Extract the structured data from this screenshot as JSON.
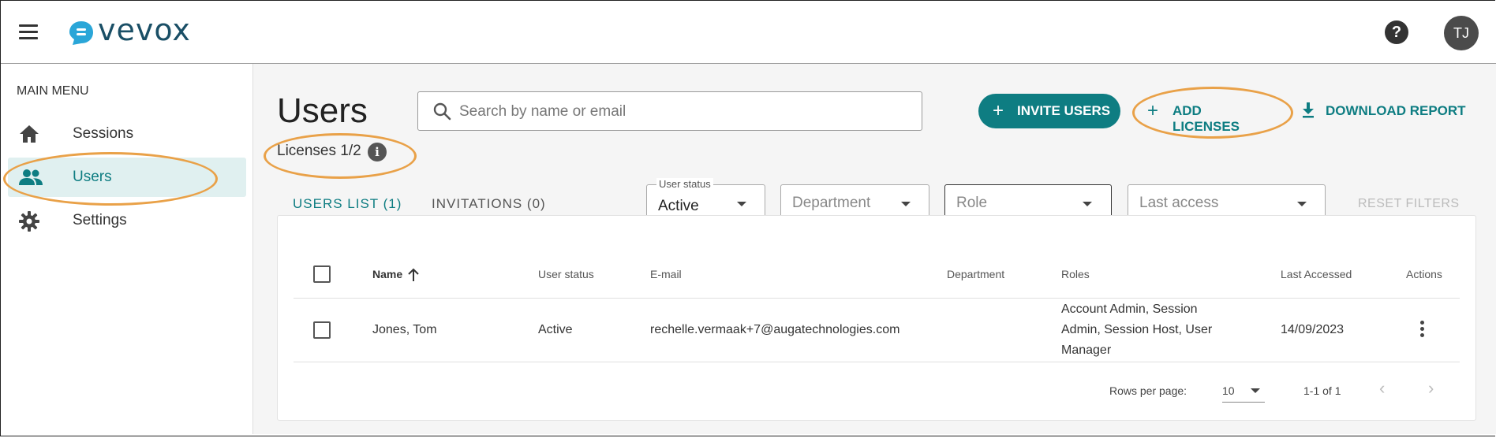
{
  "header": {
    "logo_text": "vevox",
    "avatar_initials": "TJ",
    "help_symbol": "?"
  },
  "sidebar": {
    "section_label": "MAIN MENU",
    "items": [
      {
        "label": "Sessions",
        "icon": "home-icon",
        "active": false
      },
      {
        "label": "Users",
        "icon": "people-icon",
        "active": true
      },
      {
        "label": "Settings",
        "icon": "gear-icon",
        "active": false
      }
    ]
  },
  "main": {
    "title": "Users",
    "licenses_text": "Licenses 1/2",
    "search": {
      "placeholder": "Search by name or email",
      "value": ""
    },
    "buttons": {
      "invite": "INVITE USERS",
      "add_licenses": "ADD LICENSES",
      "download_report": "DOWNLOAD REPORT"
    },
    "tabs": [
      {
        "label": "USERS LIST (1)",
        "active": true
      },
      {
        "label": "INVITATIONS (0)",
        "active": false
      }
    ],
    "filters": {
      "user_status": {
        "label": "User status",
        "value": "Active"
      },
      "department": {
        "placeholder": "Department"
      },
      "role": {
        "placeholder": "Role"
      },
      "last_access": {
        "placeholder": "Last access"
      },
      "reset": "RESET FILTERS"
    },
    "table": {
      "columns": [
        "Name",
        "User status",
        "E-mail",
        "Department",
        "Roles",
        "Last Accessed",
        "Actions"
      ],
      "sort_column": "Name",
      "sort_direction": "ascending",
      "rows": [
        {
          "name": "Jones, Tom",
          "status": "Active",
          "email": "rechelle.vermaak+7@augatechnologies.com",
          "department": "",
          "roles_lines": [
            "Account Admin, Session",
            "Admin, Session Host, User",
            "Manager"
          ],
          "last_accessed": "14/09/2023"
        }
      ],
      "footer": {
        "rows_per_page_label": "Rows per page:",
        "rows_per_page_value": "10",
        "range_text": "1-1 of 1"
      }
    }
  },
  "colors": {
    "accent": "#0e7d82",
    "highlight_ring": "#e9a148",
    "active_nav_bg": "#e0f0f0",
    "logo": "#1a4f66"
  }
}
